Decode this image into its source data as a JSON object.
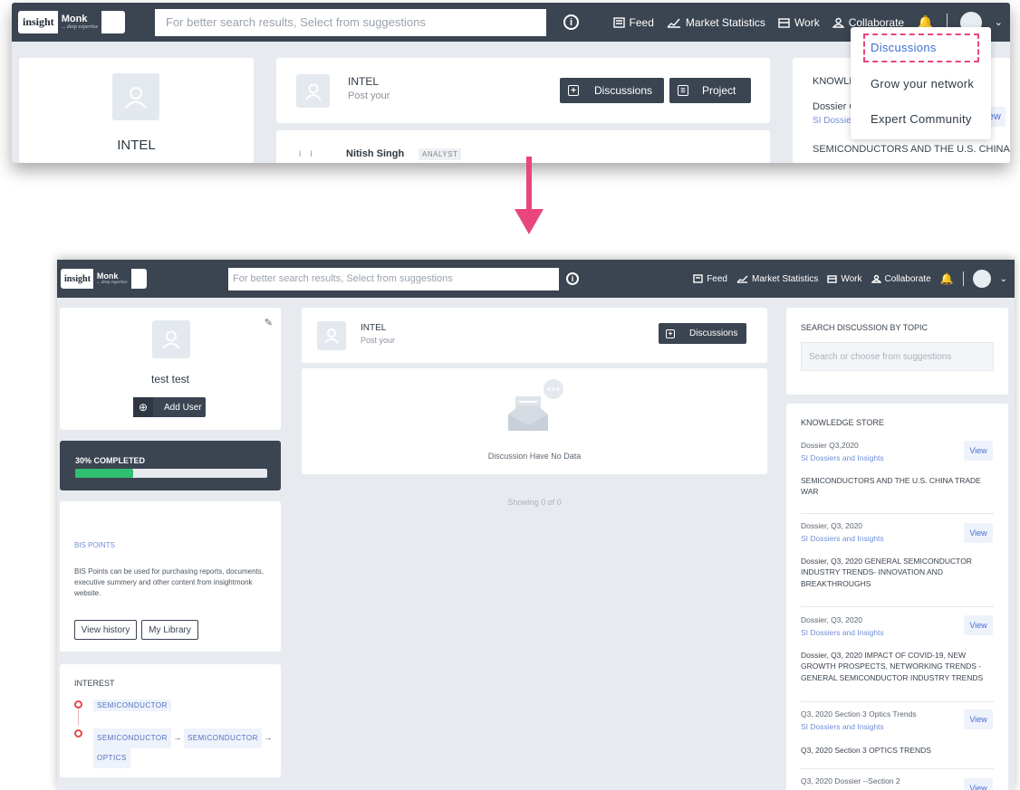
{
  "brand": {
    "logo_a": "insight",
    "logo_b": "Monk",
    "logo_beta": "Beta",
    "logo_tag": "... deep expertise"
  },
  "search": {
    "placeholder": "For better search results, Select from suggestions"
  },
  "nav": {
    "feed": "Feed",
    "market": "Market Statistics",
    "work": "Work",
    "collaborate": "Collaborate"
  },
  "dropdown": {
    "items": [
      "Discussions",
      "Grow your network",
      "Expert Community"
    ]
  },
  "top": {
    "profile_name": "INTEL",
    "post_title": "INTEL",
    "post_sub": "Post your",
    "btn_discussions": "Discussions",
    "btn_project": "Project",
    "user_name": "Nitish Singh",
    "user_badge": "ANALYST",
    "ks_title": "KNOWLEDGE STORE",
    "ks_item_title": "Dossier Q3,2020",
    "ks_item_sub": "SI Dossiers and Insights",
    "ks_view": "View",
    "ks_item_desc": "SEMICONDUCTORS AND THE U.S. CHINA"
  },
  "bottom": {
    "profile_name": "test test",
    "add_user": "Add User",
    "progress_label": "30% COMPLETED",
    "progress_value": 0.3,
    "bis_title": "BIS POINTS",
    "bis_text": "BIS Points can be used for purchasing reports, documents, executive summery and other content from insightmonk website.",
    "view_history": "View history",
    "my_library": "My Library",
    "interest_title": "INTEREST",
    "interest_1": "SEMICONDUCTOR",
    "interest_2a": "SEMICONDUCTOR",
    "interest_2b": "SEMICONDUCTOR",
    "interest_2c": "OPTICS",
    "post_title": "INTEL",
    "post_sub": "Post your",
    "btn_discussions": "Discussions",
    "no_data": "Discussion Have No Data",
    "showing": "Showing 0 of 0",
    "search_topic_title": "SEARCH DISCUSSION BY TOPIC",
    "search_topic_placeholder": "Search or choose from suggestions",
    "ks_title": "KNOWLEDGE STORE",
    "ks_view": "View",
    "ks_items": [
      {
        "title": "Dossier Q3,2020",
        "sub": "SI Dossiers and Insights",
        "desc": "SEMICONDUCTORS AND THE U.S. CHINA TRADE WAR"
      },
      {
        "title": "Dossier, Q3, 2020",
        "sub": "SI Dossiers and Insights",
        "desc": "Dossier, Q3, 2020 GENERAL SEMICONDUCTOR INDUSTRY TRENDS- INNOVATION AND BREAKTHROUGHS"
      },
      {
        "title": "Dossier, Q3, 2020",
        "sub": "SI Dossiers and Insights",
        "desc": "Dossier, Q3, 2020 IMPACT OF COVID-19, NEW GROWTH PROSPECTS, NETWORKING TRENDS - GENERAL SEMICONDUCTOR INDUSTRY TRENDS"
      },
      {
        "title": "Q3, 2020 Section 3 Optics Trends",
        "sub": "SI Dossiers and Insights",
        "desc": "Q3, 2020 Section 3 OPTICS TRENDS"
      },
      {
        "title": "Q3, 2020 Dossier --Section 2",
        "sub": "",
        "desc": ""
      }
    ]
  },
  "colors": {
    "nav": "#3b4451",
    "accent_pink": "#e8467c",
    "progress": "#2fbf71",
    "interest_dot": "#e2474a"
  }
}
